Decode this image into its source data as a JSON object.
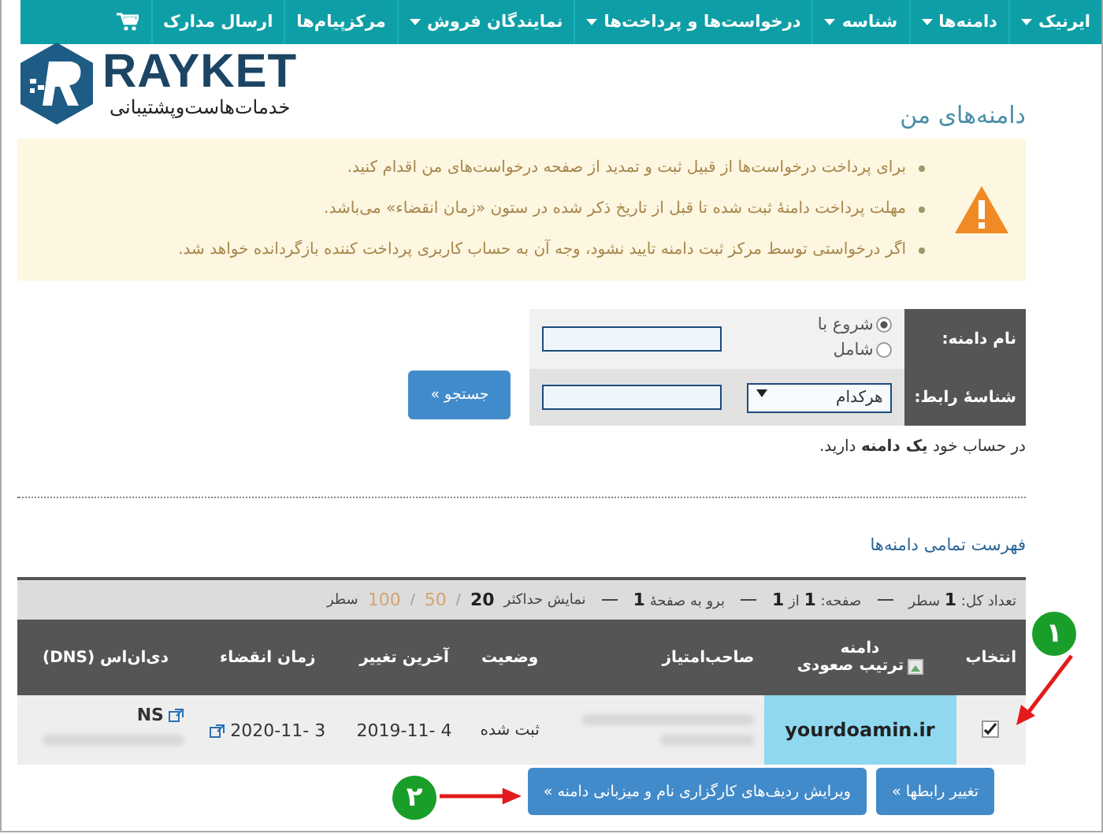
{
  "nav": {
    "items": [
      {
        "label": "ایرنیک",
        "dropdown": true
      },
      {
        "label": "دامنه‌ها",
        "dropdown": true
      },
      {
        "label": "شناسه",
        "dropdown": true
      },
      {
        "label": "درخواست‌ها و پرداخت‌ها",
        "dropdown": true
      },
      {
        "label": "نمایندگان فروش",
        "dropdown": true
      },
      {
        "label": "مرکزپیام‌ها",
        "dropdown": false
      },
      {
        "label": "ارسال مدارک",
        "dropdown": false
      }
    ]
  },
  "logo": {
    "name": "RAYKET",
    "tagline": "خدمات‌هاست‌وپشتیبانی"
  },
  "page_title": "دامنه‌های من",
  "notice": [
    "برای پرداخت درخواست‌ها از قبیل ثبت و تمدید از صفحه درخواست‌های من اقدام کنید.",
    "مهلت پرداخت دامنهٔ ثبت شده تا قبل از تاریخ ذکر شده در ستون «زمان انقضاء» می‌باشد.",
    "اگر درخواستی توسط مرکز ثبت دامنه تایید نشود، وجه آن به حساب کاربری پرداخت کننده بازگردانده خواهد شد."
  ],
  "search": {
    "domain_label": "نام دامنه:",
    "options": [
      {
        "label": "شروع با",
        "selected": true
      },
      {
        "label": "شامل",
        "selected": false
      }
    ],
    "contact_label": "شناسهٔ رابط:",
    "contact_select": "هرکدام",
    "button": "جستجو »"
  },
  "summary": "در حساب خود **یک دامنه** دارید.",
  "list_title": "فهرست تمامی دامنه‌ها",
  "pager": {
    "parts": [
      "تعداد کل: **1** سطر",
      "صفحه: **1** از **1**",
      "برو به صفحهٔ **1**"
    ],
    "size_label": "نمایش حداکثر",
    "sizes": [
      {
        "label": "20",
        "selected": true
      },
      {
        "label": "50",
        "selected": false
      },
      {
        "label": "100",
        "selected": false
      }
    ],
    "size_suffix": "سطر",
    "size_separator": "/"
  },
  "table": {
    "columns": [
      "انتخاب",
      "دامنه",
      "صاحب‌امتیاز",
      "وضعیت",
      "آخرین تغییر",
      "زمان انقضاء",
      "دی‌ان‌اس (DNS)"
    ],
    "sort_label": "ترتیب صعودی",
    "rows": [
      {
        "checked": true,
        "domain": "yourdoamin.ir",
        "status": "ثبت شده",
        "last_change": "2019-11- 4",
        "expiry": "2020-11- 3",
        "dns": "NS"
      }
    ]
  },
  "actions": [
    "تغییر رابطها »",
    "ویرایش ردیف‌های کارگزاری نام و میزبانی دامنه »"
  ],
  "callouts": [
    "۱",
    "۲"
  ]
}
